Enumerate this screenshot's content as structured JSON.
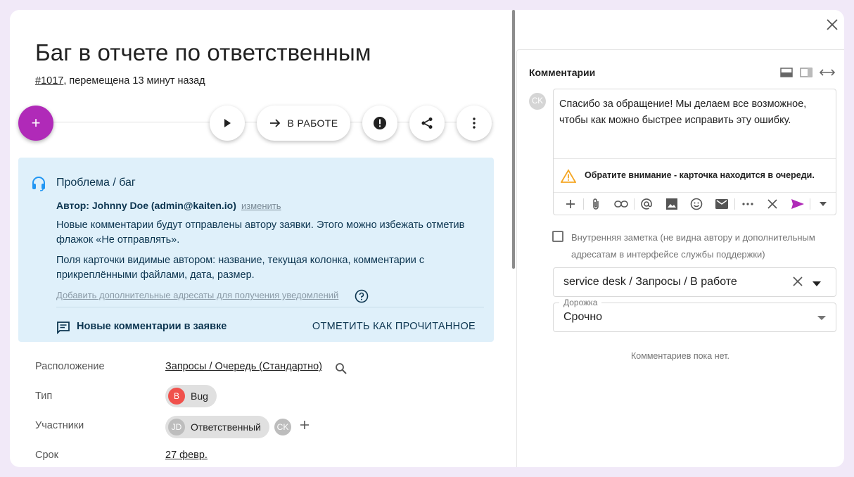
{
  "card": {
    "title": "Баг в отчете по ответственным",
    "id": "#1017",
    "moved": ", перемещена 13 минут назад"
  },
  "toolbar": {
    "add_label": "+",
    "status_label": "В РАБОТЕ"
  },
  "info": {
    "title": "Проблема / баг",
    "author": "Автор: Johnny Doe (admin@kaiten.io)",
    "change": "изменить",
    "text1": "Новые комментарии будут отправлены автору заявки. Этого можно избежать отметив флажок «Не отправлять».",
    "text2": "Поля карточки видимые автором: название, текущая колонка, комментарии с прикреплёнными файлами, дата, размер.",
    "add_recipients": "Добавить дополнительные адресаты для получения уведомлений",
    "new_comments": "Новые комментарии в заявке",
    "mark_read": "ОТМЕТИТЬ КАК ПРОЧИТАННОЕ"
  },
  "props": {
    "location_label": "Расположение",
    "location_value": "Запросы / Очередь (Стандартно)",
    "type_label": "Тип",
    "type_avatar": "B",
    "type_value": "Bug",
    "members_label": "Участники",
    "member_avatar": "JD",
    "member_role": "Ответственный",
    "member2_avatar": "CK",
    "deadline_label": "Срок",
    "deadline_value": "27 февр."
  },
  "comments": {
    "title": "Комментарии",
    "avatar": "CK",
    "draft": "Спасибо за обращение! Мы делаем все возможное, чтобы как можно быстрее исправить эту ошибку.",
    "warning": "Обратите внимание - карточка находится в очереди.",
    "internal_note": "Внутренняя заметка (не видна автору и дополнительным адресатам в интерфейсе службы поддержки)",
    "path_value": "service desk / Запросы / В работе",
    "lane_label": "Дорожка",
    "lane_value": "Срочно",
    "empty": "Комментариев пока нет."
  },
  "colors": {
    "accent": "#b02ab8",
    "info_bg": "#dff0fa",
    "info_text": "#0c3550",
    "bug": "#f0514c",
    "warning": "#f5a623"
  }
}
